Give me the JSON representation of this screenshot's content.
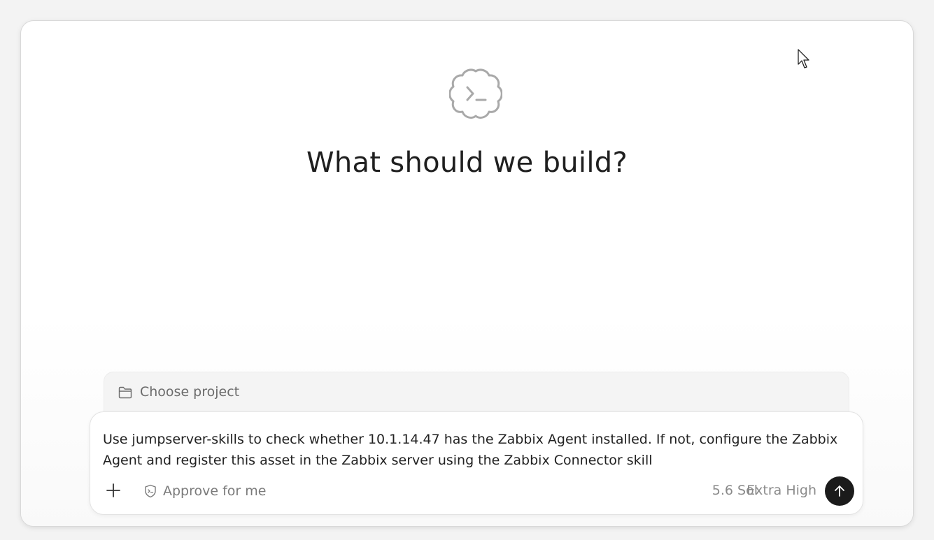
{
  "main": {
    "heading": "What should we build?",
    "logo_icon": "terminal-cloud-icon"
  },
  "project": {
    "label": "Choose project",
    "icon": "folder-icon"
  },
  "composer": {
    "prompt_text": "Use jumpserver-skills to check whether 10.1.14.47 has the Zabbix Agent installed. If not, configure the Zabbix Agent and register this asset in the Zabbix server using the Zabbix Connector skill",
    "add_icon": "plus-icon",
    "approve_label": "Approve for me",
    "approve_icon": "shield-icon",
    "model_label": "5.6 Sol",
    "effort_label": "Extra High",
    "send_icon": "arrow-up-icon"
  },
  "colors": {
    "send_button": "#1b1b1b",
    "muted_text": "#8a8a8a"
  }
}
